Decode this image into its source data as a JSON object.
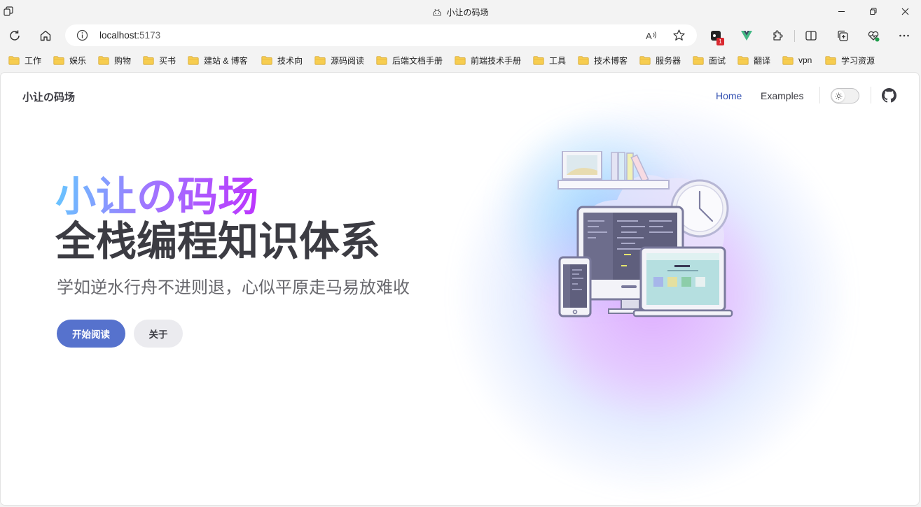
{
  "window": {
    "title": "小让の码场",
    "controls": [
      "minimize-icon",
      "restore-icon",
      "close-icon"
    ]
  },
  "toolbar": {
    "url_host": "localhost:",
    "url_port": "5173",
    "extension_badge": "1"
  },
  "bookmarks": [
    {
      "label": "工作"
    },
    {
      "label": "娱乐"
    },
    {
      "label": "购物"
    },
    {
      "label": "买书"
    },
    {
      "label": "建站 & 博客"
    },
    {
      "label": "技术向"
    },
    {
      "label": "源码阅读"
    },
    {
      "label": "后端文档手册"
    },
    {
      "label": "前端技术手册"
    },
    {
      "label": "工具"
    },
    {
      "label": "技术博客"
    },
    {
      "label": "服务器"
    },
    {
      "label": "面试"
    },
    {
      "label": "翻译"
    },
    {
      "label": "vpn"
    },
    {
      "label": "学习资源"
    }
  ],
  "site": {
    "title": "小让の码场",
    "nav": [
      {
        "label": "Home",
        "active": true
      },
      {
        "label": "Examples",
        "active": false
      }
    ],
    "theme_toggle_icon": "sun-icon",
    "social_icon": "github-icon"
  },
  "hero": {
    "name": "小让の码场",
    "text": "全栈编程知识体系",
    "tagline": "学如逆水行舟不进则退，心似平原走马易放难收",
    "actions": [
      {
        "label": "开始阅读",
        "theme": "brand"
      },
      {
        "label": "关于",
        "theme": "alt"
      }
    ]
  },
  "colors": {
    "brand": "#5672cd",
    "nav_active": "#3451b2",
    "text_main": "#3c3c43",
    "gradient_start": "#66c8ff",
    "gradient_end": "#bd34fe"
  }
}
